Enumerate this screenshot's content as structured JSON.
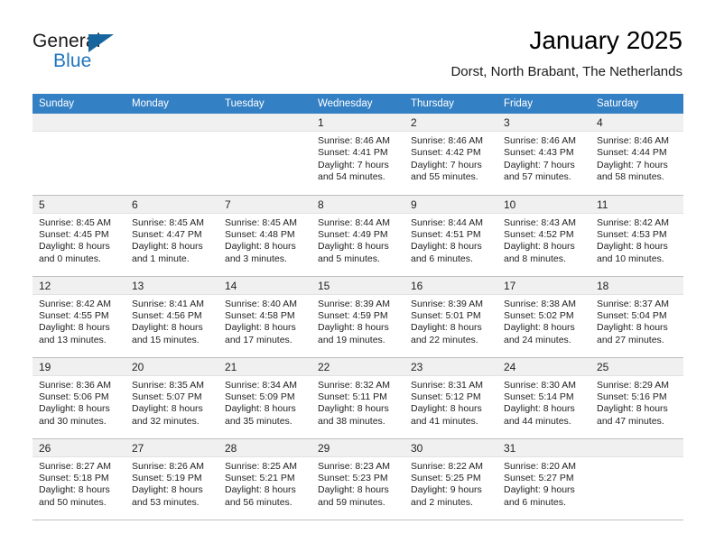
{
  "brand": {
    "name_part1": "General",
    "name_part2": "Blue",
    "triangle_icon": "triangle-logo-icon",
    "accent_color": "#1f74bd",
    "triangle_color": "#16659e"
  },
  "header": {
    "title": "January 2025",
    "subtitle": "Dorst, North Brabant, The Netherlands"
  },
  "calendar": {
    "header_bg": "#3480c4",
    "daynum_bg": "#f0f0f0",
    "grid_line_color": "#bfbfbf",
    "weekday_headers": [
      "Sunday",
      "Monday",
      "Tuesday",
      "Wednesday",
      "Thursday",
      "Friday",
      "Saturday"
    ],
    "weeks": [
      [
        {
          "day": "",
          "empty": true,
          "sunrise": "",
          "sunset": "",
          "daylight_line1": "",
          "daylight_line2": ""
        },
        {
          "day": "",
          "empty": true,
          "sunrise": "",
          "sunset": "",
          "daylight_line1": "",
          "daylight_line2": ""
        },
        {
          "day": "",
          "empty": true,
          "sunrise": "",
          "sunset": "",
          "daylight_line1": "",
          "daylight_line2": ""
        },
        {
          "day": "1",
          "empty": false,
          "sunrise": "Sunrise: 8:46 AM",
          "sunset": "Sunset: 4:41 PM",
          "daylight_line1": "Daylight: 7 hours",
          "daylight_line2": "and 54 minutes."
        },
        {
          "day": "2",
          "empty": false,
          "sunrise": "Sunrise: 8:46 AM",
          "sunset": "Sunset: 4:42 PM",
          "daylight_line1": "Daylight: 7 hours",
          "daylight_line2": "and 55 minutes."
        },
        {
          "day": "3",
          "empty": false,
          "sunrise": "Sunrise: 8:46 AM",
          "sunset": "Sunset: 4:43 PM",
          "daylight_line1": "Daylight: 7 hours",
          "daylight_line2": "and 57 minutes."
        },
        {
          "day": "4",
          "empty": false,
          "sunrise": "Sunrise: 8:46 AM",
          "sunset": "Sunset: 4:44 PM",
          "daylight_line1": "Daylight: 7 hours",
          "daylight_line2": "and 58 minutes."
        }
      ],
      [
        {
          "day": "5",
          "empty": false,
          "sunrise": "Sunrise: 8:45 AM",
          "sunset": "Sunset: 4:45 PM",
          "daylight_line1": "Daylight: 8 hours",
          "daylight_line2": "and 0 minutes."
        },
        {
          "day": "6",
          "empty": false,
          "sunrise": "Sunrise: 8:45 AM",
          "sunset": "Sunset: 4:47 PM",
          "daylight_line1": "Daylight: 8 hours",
          "daylight_line2": "and 1 minute."
        },
        {
          "day": "7",
          "empty": false,
          "sunrise": "Sunrise: 8:45 AM",
          "sunset": "Sunset: 4:48 PM",
          "daylight_line1": "Daylight: 8 hours",
          "daylight_line2": "and 3 minutes."
        },
        {
          "day": "8",
          "empty": false,
          "sunrise": "Sunrise: 8:44 AM",
          "sunset": "Sunset: 4:49 PM",
          "daylight_line1": "Daylight: 8 hours",
          "daylight_line2": "and 5 minutes."
        },
        {
          "day": "9",
          "empty": false,
          "sunrise": "Sunrise: 8:44 AM",
          "sunset": "Sunset: 4:51 PM",
          "daylight_line1": "Daylight: 8 hours",
          "daylight_line2": "and 6 minutes."
        },
        {
          "day": "10",
          "empty": false,
          "sunrise": "Sunrise: 8:43 AM",
          "sunset": "Sunset: 4:52 PM",
          "daylight_line1": "Daylight: 8 hours",
          "daylight_line2": "and 8 minutes."
        },
        {
          "day": "11",
          "empty": false,
          "sunrise": "Sunrise: 8:42 AM",
          "sunset": "Sunset: 4:53 PM",
          "daylight_line1": "Daylight: 8 hours",
          "daylight_line2": "and 10 minutes."
        }
      ],
      [
        {
          "day": "12",
          "empty": false,
          "sunrise": "Sunrise: 8:42 AM",
          "sunset": "Sunset: 4:55 PM",
          "daylight_line1": "Daylight: 8 hours",
          "daylight_line2": "and 13 minutes."
        },
        {
          "day": "13",
          "empty": false,
          "sunrise": "Sunrise: 8:41 AM",
          "sunset": "Sunset: 4:56 PM",
          "daylight_line1": "Daylight: 8 hours",
          "daylight_line2": "and 15 minutes."
        },
        {
          "day": "14",
          "empty": false,
          "sunrise": "Sunrise: 8:40 AM",
          "sunset": "Sunset: 4:58 PM",
          "daylight_line1": "Daylight: 8 hours",
          "daylight_line2": "and 17 minutes."
        },
        {
          "day": "15",
          "empty": false,
          "sunrise": "Sunrise: 8:39 AM",
          "sunset": "Sunset: 4:59 PM",
          "daylight_line1": "Daylight: 8 hours",
          "daylight_line2": "and 19 minutes."
        },
        {
          "day": "16",
          "empty": false,
          "sunrise": "Sunrise: 8:39 AM",
          "sunset": "Sunset: 5:01 PM",
          "daylight_line1": "Daylight: 8 hours",
          "daylight_line2": "and 22 minutes."
        },
        {
          "day": "17",
          "empty": false,
          "sunrise": "Sunrise: 8:38 AM",
          "sunset": "Sunset: 5:02 PM",
          "daylight_line1": "Daylight: 8 hours",
          "daylight_line2": "and 24 minutes."
        },
        {
          "day": "18",
          "empty": false,
          "sunrise": "Sunrise: 8:37 AM",
          "sunset": "Sunset: 5:04 PM",
          "daylight_line1": "Daylight: 8 hours",
          "daylight_line2": "and 27 minutes."
        }
      ],
      [
        {
          "day": "19",
          "empty": false,
          "sunrise": "Sunrise: 8:36 AM",
          "sunset": "Sunset: 5:06 PM",
          "daylight_line1": "Daylight: 8 hours",
          "daylight_line2": "and 30 minutes."
        },
        {
          "day": "20",
          "empty": false,
          "sunrise": "Sunrise: 8:35 AM",
          "sunset": "Sunset: 5:07 PM",
          "daylight_line1": "Daylight: 8 hours",
          "daylight_line2": "and 32 minutes."
        },
        {
          "day": "21",
          "empty": false,
          "sunrise": "Sunrise: 8:34 AM",
          "sunset": "Sunset: 5:09 PM",
          "daylight_line1": "Daylight: 8 hours",
          "daylight_line2": "and 35 minutes."
        },
        {
          "day": "22",
          "empty": false,
          "sunrise": "Sunrise: 8:32 AM",
          "sunset": "Sunset: 5:11 PM",
          "daylight_line1": "Daylight: 8 hours",
          "daylight_line2": "and 38 minutes."
        },
        {
          "day": "23",
          "empty": false,
          "sunrise": "Sunrise: 8:31 AM",
          "sunset": "Sunset: 5:12 PM",
          "daylight_line1": "Daylight: 8 hours",
          "daylight_line2": "and 41 minutes."
        },
        {
          "day": "24",
          "empty": false,
          "sunrise": "Sunrise: 8:30 AM",
          "sunset": "Sunset: 5:14 PM",
          "daylight_line1": "Daylight: 8 hours",
          "daylight_line2": "and 44 minutes."
        },
        {
          "day": "25",
          "empty": false,
          "sunrise": "Sunrise: 8:29 AM",
          "sunset": "Sunset: 5:16 PM",
          "daylight_line1": "Daylight: 8 hours",
          "daylight_line2": "and 47 minutes."
        }
      ],
      [
        {
          "day": "26",
          "empty": false,
          "sunrise": "Sunrise: 8:27 AM",
          "sunset": "Sunset: 5:18 PM",
          "daylight_line1": "Daylight: 8 hours",
          "daylight_line2": "and 50 minutes."
        },
        {
          "day": "27",
          "empty": false,
          "sunrise": "Sunrise: 8:26 AM",
          "sunset": "Sunset: 5:19 PM",
          "daylight_line1": "Daylight: 8 hours",
          "daylight_line2": "and 53 minutes."
        },
        {
          "day": "28",
          "empty": false,
          "sunrise": "Sunrise: 8:25 AM",
          "sunset": "Sunset: 5:21 PM",
          "daylight_line1": "Daylight: 8 hours",
          "daylight_line2": "and 56 minutes."
        },
        {
          "day": "29",
          "empty": false,
          "sunrise": "Sunrise: 8:23 AM",
          "sunset": "Sunset: 5:23 PM",
          "daylight_line1": "Daylight: 8 hours",
          "daylight_line2": "and 59 minutes."
        },
        {
          "day": "30",
          "empty": false,
          "sunrise": "Sunrise: 8:22 AM",
          "sunset": "Sunset: 5:25 PM",
          "daylight_line1": "Daylight: 9 hours",
          "daylight_line2": "and 2 minutes."
        },
        {
          "day": "31",
          "empty": false,
          "sunrise": "Sunrise: 8:20 AM",
          "sunset": "Sunset: 5:27 PM",
          "daylight_line1": "Daylight: 9 hours",
          "daylight_line2": "and 6 minutes."
        },
        {
          "day": "",
          "empty": true,
          "sunrise": "",
          "sunset": "",
          "daylight_line1": "",
          "daylight_line2": ""
        }
      ]
    ]
  }
}
